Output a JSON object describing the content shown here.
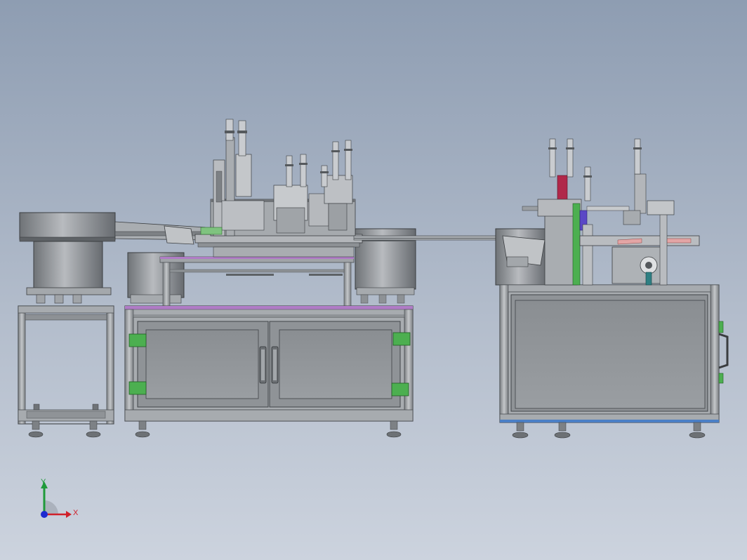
{
  "viewport": {
    "background_top": "#8e9db2",
    "background_bottom": "#ccd3de"
  },
  "model": {
    "colors": {
      "frame": "#9ea3a8",
      "frame_dark": "#5d6166",
      "panel": "#8b8f93",
      "panel_light": "#b9bcc0",
      "accent_purple": "#b07cc6",
      "accent_green": "#4caf50",
      "accent_red": "#b0284a",
      "accent_pink": "#e3a5a5",
      "accent_teal": "#2f7f83",
      "accent_blue": "#4a7fc6"
    }
  },
  "triad": {
    "x_label": "X",
    "y_label": "Y",
    "x_color": "#d0202a",
    "y_color": "#1f9a3a",
    "z_color": "#1e2ad0"
  }
}
